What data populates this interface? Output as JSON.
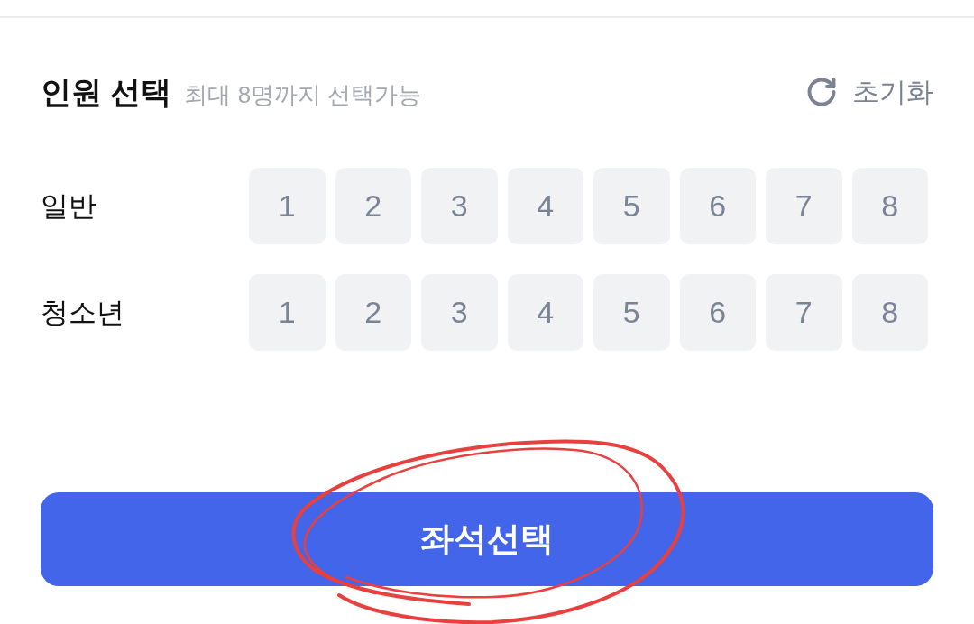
{
  "header": {
    "title": "인원 선택",
    "subtitle": "최대 8명까지 선택가능",
    "reset": {
      "label": "초기화"
    }
  },
  "groups": [
    {
      "label": "일반",
      "counts": [
        {
          "label": "1",
          "selected": false
        },
        {
          "label": "2",
          "selected": false
        },
        {
          "label": "3",
          "selected": false
        },
        {
          "label": "4",
          "selected": false
        },
        {
          "label": "5",
          "selected": false
        },
        {
          "label": "6",
          "selected": false
        },
        {
          "label": "7",
          "selected": false
        },
        {
          "label": "8",
          "selected": false
        }
      ]
    },
    {
      "label": "청소년",
      "counts": [
        {
          "label": "1",
          "selected": false
        },
        {
          "label": "2",
          "selected": false
        },
        {
          "label": "3",
          "selected": false
        },
        {
          "label": "4",
          "selected": false
        },
        {
          "label": "5",
          "selected": false
        },
        {
          "label": "6",
          "selected": false
        },
        {
          "label": "7",
          "selected": false
        },
        {
          "label": "8",
          "selected": false
        }
      ]
    }
  ],
  "primary_button": {
    "label": "좌석선택"
  }
}
